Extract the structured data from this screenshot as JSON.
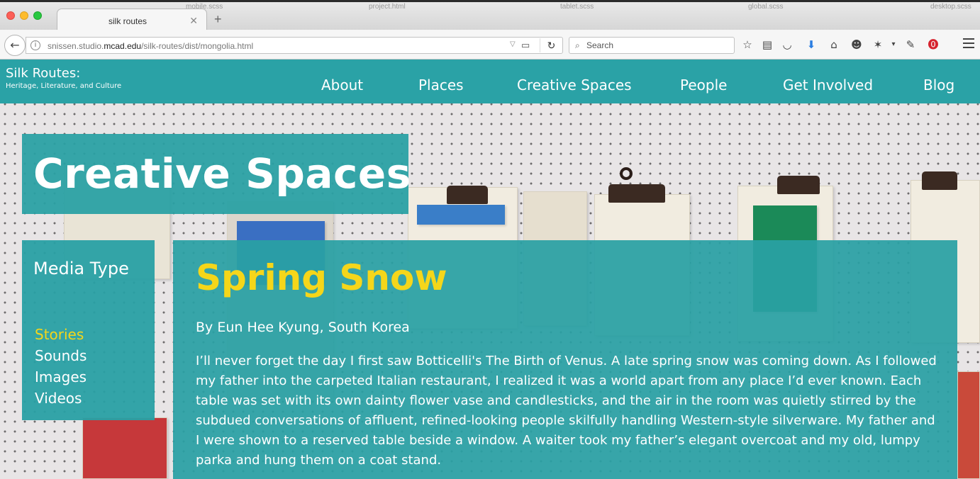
{
  "browser": {
    "tab_title": "silk routes",
    "background_tabs": [
      "mobile.scss",
      "project.html",
      "tablet.scss",
      "global.scss",
      "desktop.scss"
    ],
    "url_prefix": "snissen.studio.",
    "url_host": "mcad.edu",
    "url_path": "/silk-routes/dist/mongolia.html",
    "search_placeholder": "Search",
    "icons": [
      "bookmark-star-icon",
      "reading-list-icon",
      "pocket-icon",
      "download-icon",
      "home-icon",
      "emoji-icon",
      "extension-icon",
      "pen-icon",
      "pinterest-icon",
      "menu-icon"
    ]
  },
  "site": {
    "logo_title": "Silk Routes:",
    "logo_subtitle": "Heritage, Literature, and Culture",
    "nav": [
      "About",
      "Places",
      "Creative Spaces",
      "People",
      "Get Involved",
      "Blog"
    ],
    "hero_title": "Creative Spaces",
    "sidebar": {
      "title": "Media Type",
      "items": [
        "Stories",
        "Sounds",
        "Images",
        "Videos"
      ],
      "active_item": "Stories"
    },
    "article": {
      "title": "Spring Snow",
      "byline": "By Eun Hee Kyung, South Korea",
      "body": "I’ll never forget the day I first saw Botticelli's The Birth of Venus. A late spring snow was coming down. As I followed my father into the carpeted Italian restaurant, I realized it was a world apart from any place I’d ever known. Each table was set with its own dainty flower vase and candlesticks, and the air in the room was quietly stirred by the subdued conversations of affluent, refined-looking people skilfully handling Western-style silverware. My father and I were shown to a reserved table beside a window. A waiter took my father’s elegant overcoat and my old, lumpy parka and hung them on a coat stand."
    },
    "colors": {
      "teal": "#2aa2a6",
      "accent_yellow": "#f5d61a",
      "text_white": "#ffffff"
    }
  }
}
